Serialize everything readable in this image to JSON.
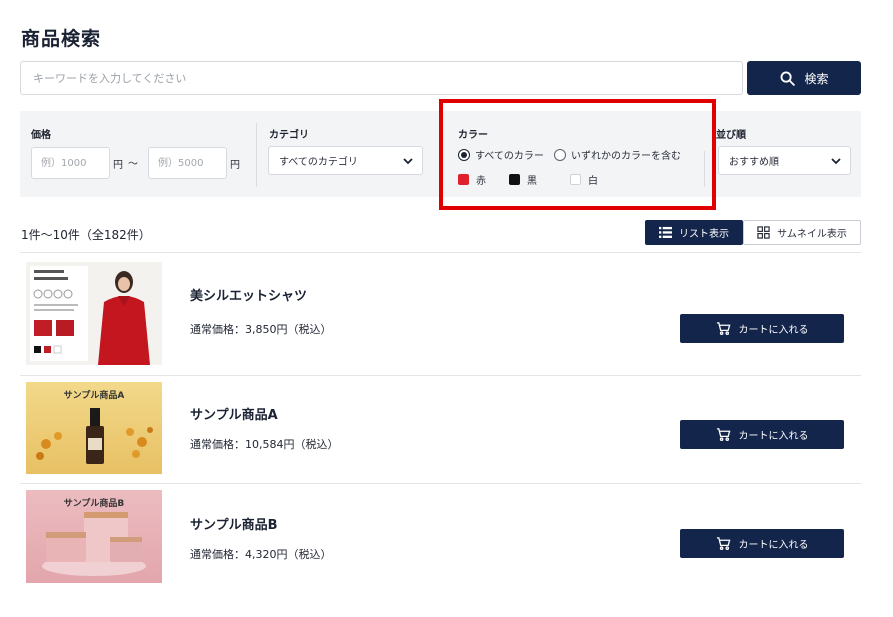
{
  "page": {
    "title": "商品検索"
  },
  "search": {
    "placeholder": "キーワードを入力してください",
    "value": "",
    "button_label": "検索"
  },
  "filters": {
    "price": {
      "label": "価格",
      "min_placeholder": "例）1000",
      "max_placeholder": "例）5000",
      "unit": "円",
      "separator": "〜"
    },
    "category": {
      "label": "カテゴリ",
      "selected": "すべてのカテゴリ"
    },
    "color": {
      "label": "カラー",
      "options": [
        {
          "label": "すべてのカラー",
          "checked": true
        },
        {
          "label": "いずれかのカラーを含む",
          "checked": false
        }
      ],
      "swatches": [
        {
          "label": "赤",
          "color": "#e0202a"
        },
        {
          "label": "黒",
          "color": "#111111"
        },
        {
          "label": "白",
          "color": "#ffffff"
        }
      ]
    },
    "sort": {
      "label": "並び順",
      "selected": "おすすめ順"
    }
  },
  "results": {
    "count_text": "1件〜10件（全182件）",
    "view_list_label": "リスト表示",
    "view_thumbnail_label": "サムネイル表示"
  },
  "products": [
    {
      "name": "美シルエットシャツ",
      "price": "通常価格：3,850円（税込）",
      "cart_label": "カートに入れる",
      "image_label": ""
    },
    {
      "name": "サンプル商品A",
      "price": "通常価格：10,584円（税込）",
      "cart_label": "カートに入れる",
      "image_label": "サンプル商品A"
    },
    {
      "name": "サンプル商品B",
      "price": "通常価格：4,320円（税込）",
      "cart_label": "カートに入れる",
      "image_label": "サンプル商品B"
    }
  ],
  "colors": {
    "primary": "#14254b",
    "highlight": "#e00000",
    "panel_bg": "#f3f4f6"
  }
}
